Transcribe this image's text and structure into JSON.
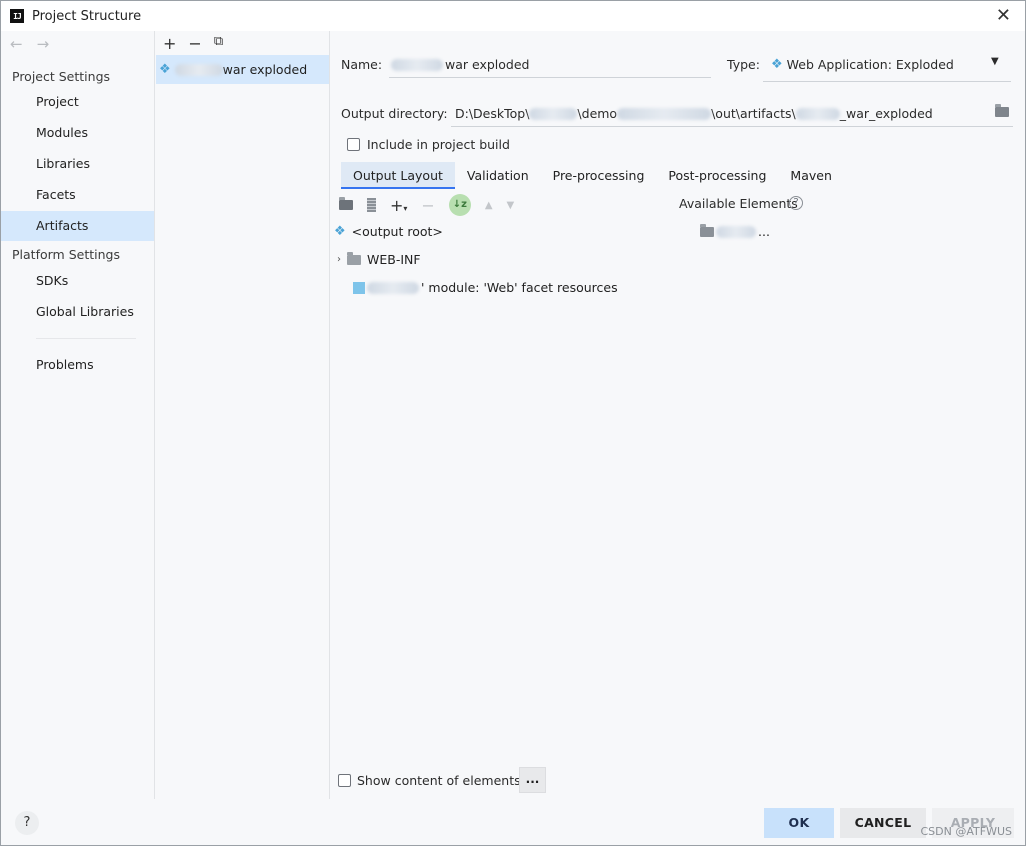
{
  "window": {
    "title": "Project Structure",
    "app_icon_text": "IJ",
    "close_glyph": "✕"
  },
  "nav": {
    "back_glyph": "←",
    "forward_glyph": "→",
    "project_settings_header": "Project Settings",
    "project_items": [
      {
        "label": "Project"
      },
      {
        "label": "Modules"
      },
      {
        "label": "Libraries"
      },
      {
        "label": "Facets"
      },
      {
        "label": "Artifacts",
        "selected": true
      }
    ],
    "platform_settings_header": "Platform Settings",
    "platform_items": [
      {
        "label": "SDKs"
      },
      {
        "label": "Global Libraries"
      }
    ],
    "problems_label": "Problems"
  },
  "artifacts_list": {
    "toolbar": {
      "add": "+",
      "remove": "−",
      "copy": "⧉"
    },
    "items": [
      {
        "label_suffix": "war exploded"
      }
    ]
  },
  "artifact": {
    "name_label": "Name:",
    "name_value_suffix": "war exploded",
    "type_label": "Type:",
    "type_value": "Web Application: Exploded",
    "output_dir_label": "Output directory:",
    "output_dir_parts": [
      "D:\\DeskTop\\",
      "\\demo",
      "\\out\\artifacts\\",
      "_war_exploded"
    ],
    "include_in_build_label": "Include in project build",
    "include_in_build_checked": false,
    "tabs": [
      {
        "label": "Output Layout",
        "active": true
      },
      {
        "label": "Validation"
      },
      {
        "label": "Pre-processing"
      },
      {
        "label": "Post-processing"
      },
      {
        "label": "Maven"
      }
    ],
    "available_elements_label": "Available Elements",
    "tree": {
      "root": "<output root>",
      "web_inf": "WEB-INF",
      "facet_resources": "' module: 'Web' facet resources"
    },
    "available_item_suffix": "...",
    "show_content_label": "Show content of elements",
    "show_content_checked": false,
    "dots_button": "..."
  },
  "footer": {
    "help": "?",
    "ok": "OK",
    "cancel": "CANCEL",
    "apply": "APPLY",
    "watermark": "CSDN @ATFWUS"
  },
  "colors": {
    "selection": "#d5e8fc",
    "accent": "#3574f0",
    "ok_button": "#c8e1fb"
  }
}
